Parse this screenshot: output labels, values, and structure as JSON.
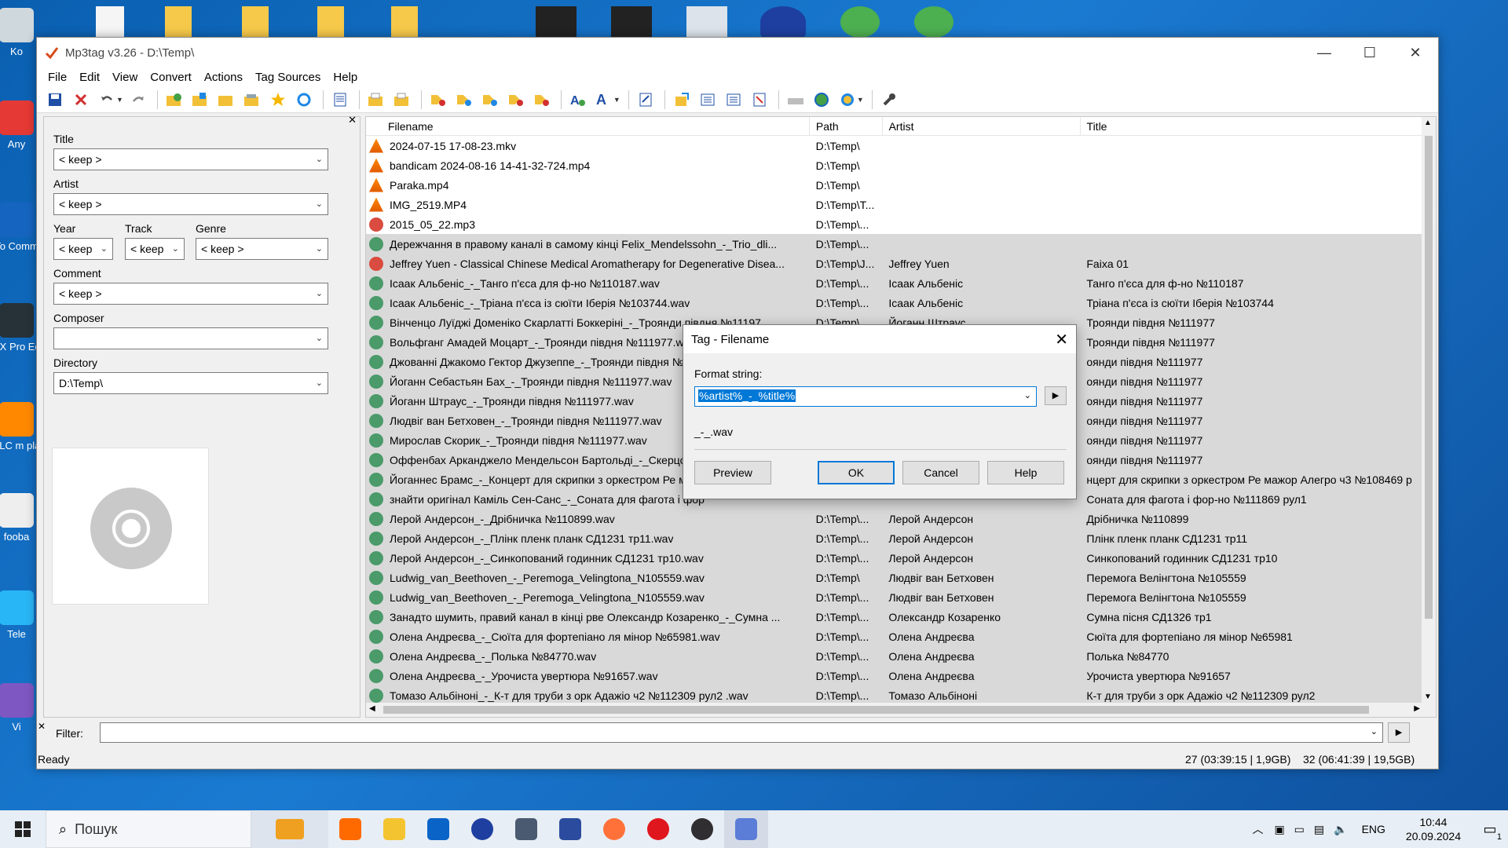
{
  "desktop": {
    "icons": [
      {
        "label": "Ko",
        "color": "#cfd8dc"
      },
      {
        "label": "Any",
        "color": "#e53935"
      },
      {
        "label": "To Comm",
        "color": "#1565c0"
      },
      {
        "label": "RX Pro Ed",
        "color": "#263238"
      },
      {
        "label": "VLC m pla",
        "color": "#ff8800"
      },
      {
        "label": "fooba",
        "color": "#eeeeee"
      },
      {
        "label": "Tele",
        "color": "#29b6f6"
      },
      {
        "label": "Vi",
        "color": "#7e57c2"
      }
    ]
  },
  "window": {
    "title": "Mp3tag v3.26  -  D:\\Temp\\",
    "controls": {
      "minimize": "—",
      "maximize": "☐",
      "close": "✕"
    }
  },
  "menu": [
    "File",
    "Edit",
    "View",
    "Convert",
    "Actions",
    "Tag Sources",
    "Help"
  ],
  "toolbar": {
    "icons": [
      "save-icon",
      "remove-tag-icon",
      "undo-icon",
      "redo-icon",
      "add-directory-icon",
      "add-file-icon",
      "open-folder-icon",
      "favorites-icon",
      "star-icon",
      "refresh-icon",
      "tag-panel-icon",
      "playlist-icon",
      "export-icon",
      "tag-filename-icon",
      "filename-tag-icon",
      "text-tag-icon",
      "tag-tag-icon",
      "autonumber-icon",
      "case-conversion-icon",
      "font-icon",
      "extended-tags-icon",
      "move-icon",
      "tag-source-icon",
      "web-icon",
      "globe-icon",
      "settings-wrench-icon"
    ]
  },
  "tagpanel": {
    "title_label": "Title",
    "title_value": "< keep >",
    "artist_label": "Artist",
    "artist_value": "< keep >",
    "year_label": "Year",
    "year_value": "< keep",
    "track_label": "Track",
    "track_value": "< keep",
    "genre_label": "Genre",
    "genre_value": "< keep >",
    "comment_label": "Comment",
    "comment_value": "< keep >",
    "composer_label": "Composer",
    "composer_value": "",
    "directory_label": "Directory",
    "directory_value": "D:\\Temp\\"
  },
  "list": {
    "columns": [
      "Filename",
      "Path",
      "Artist",
      "Title"
    ],
    "rows": [
      {
        "type": "vlc",
        "file": "2024-07-15 17-08-23.mkv",
        "path": "D:\\Temp\\",
        "artist": "",
        "title": "",
        "sel": false
      },
      {
        "type": "vlc",
        "file": "bandicam 2024-08-16 14-41-32-724.mp4",
        "path": "D:\\Temp\\",
        "artist": "",
        "title": "",
        "sel": false
      },
      {
        "type": "vlc",
        "file": "Paraka.mp4",
        "path": "D:\\Temp\\",
        "artist": "",
        "title": "",
        "sel": false
      },
      {
        "type": "vlc",
        "file": "IMG_2519.MP4",
        "path": "D:\\Temp\\T...",
        "artist": "",
        "title": "",
        "sel": false
      },
      {
        "type": "mp3",
        "file": "2015_05_22.mp3",
        "path": "D:\\Temp\\...",
        "artist": "",
        "title": "",
        "sel": false
      },
      {
        "type": "wav",
        "file": "Дережчання в правому каналі в самому кінці Felix_Mendelssohn_-_Trio_dli...",
        "path": "D:\\Temp\\...",
        "artist": "",
        "title": "",
        "sel": true
      },
      {
        "type": "mp3",
        "file": "Jeffrey Yuen - Classical Chinese Medical Aromatherapy for Degenerative Disea...",
        "path": "D:\\Temp\\J...",
        "artist": "Jeffrey Yuen",
        "title": "Faixa 01",
        "sel": true
      },
      {
        "type": "wav",
        "file": "Ісаак Альбеніс_-_Танго п'єса для ф-но №110187.wav",
        "path": "D:\\Temp\\...",
        "artist": "Ісаак Альбеніс",
        "title": "Танго п'єса для ф-но №110187",
        "sel": true
      },
      {
        "type": "wav",
        "file": "Ісаак Альбеніс_-_Тріана п'єса із сюїти Іберія №103744.wav",
        "path": "D:\\Temp\\...",
        "artist": "Ісаак Альбеніс",
        "title": "Тріана п'єса із сюїти Іберія №103744",
        "sel": true
      },
      {
        "type": "wav",
        "file": "Вінченцо Луїджі Доменіко Скарлатті Боккеріні_-_Троянди півдня №11197...",
        "path": "D:\\Temp\\...",
        "artist": "Йоганн Штраус",
        "title": "Троянди півдня №111977",
        "sel": true
      },
      {
        "type": "wav",
        "file": "Вольфганг Амадей Моцарт_-_Троянди півдня №111977.wav",
        "path": "D:\\Temp\\...",
        "artist": "",
        "title": "Троянди півдня №111977",
        "sel": true
      },
      {
        "type": "wav",
        "file": "Джованні Джакомо Гектор Джузеппе_-_Троянди півдня №1",
        "path": "",
        "artist": "",
        "title": "оянди півдня №111977",
        "sel": true
      },
      {
        "type": "wav",
        "file": "Йоганн Себастьян Бах_-_Троянди півдня №111977.wav",
        "path": "",
        "artist": "",
        "title": "оянди півдня №111977",
        "sel": true
      },
      {
        "type": "wav",
        "file": "Йоганн Штраус_-_Троянди півдня №111977.wav",
        "path": "",
        "artist": "",
        "title": "оянди півдня №111977",
        "sel": true
      },
      {
        "type": "wav",
        "file": "Людвіг ван Бетховен_-_Троянди півдня №111977.wav",
        "path": "",
        "artist": "",
        "title": "оянди півдня №111977",
        "sel": true
      },
      {
        "type": "wav",
        "file": "Мирослав Скорик_-_Троянди півдня №111977.wav",
        "path": "",
        "artist": "",
        "title": "оянди півдня №111977",
        "sel": true
      },
      {
        "type": "wav",
        "file": "Оффенбах Арканджело Мендельсон Бартольді_-_Скерцо Тр",
        "path": "",
        "artist": "",
        "title": "оянди півдня №111977",
        "sel": true
      },
      {
        "type": "wav",
        "file": "Йоганнес Брамс_-_Концерт для скрипки з оркестром Ре ма",
        "path": "",
        "artist": "",
        "title": "нцерт для скрипки з оркестром Ре мажор Алегро ч3 №108469 р",
        "sel": true
      },
      {
        "type": "wav",
        "file": "знайти оригінал Каміль Сен-Санс_-_Соната для фагота і фор",
        "path": "",
        "artist": "",
        "title": "Соната для фагота і фор-но №111869 рул1",
        "sel": true
      },
      {
        "type": "wav",
        "file": "Лерой Андерсон_-_Дрібничка №110899.wav",
        "path": "D:\\Temp\\...",
        "artist": "Лерой Андерсон",
        "title": "Дрібничка №110899",
        "sel": true
      },
      {
        "type": "wav",
        "file": "Лерой Андерсон_-_Плінк пленк планк СД1231 тр11.wav",
        "path": "D:\\Temp\\...",
        "artist": "Лерой Андерсон",
        "title": "Плінк пленк планк СД1231 тр11",
        "sel": true
      },
      {
        "type": "wav",
        "file": "Лерой Андерсон_-_Синкопований годинник СД1231 тр10.wav",
        "path": "D:\\Temp\\...",
        "artist": "Лерой Андерсон",
        "title": "Синкопований годинник СД1231 тр10",
        "sel": true
      },
      {
        "type": "wav",
        "file": "Ludwig_van_Beethoven_-_Peremoga_Velingtona_N105559.wav",
        "path": "D:\\Temp\\",
        "artist": "Людвіг ван Бетховен",
        "title": "Перемога Велінгтона №105559",
        "sel": true
      },
      {
        "type": "wav",
        "file": "Ludwig_van_Beethoven_-_Peremoga_Velingtona_N105559.wav",
        "path": "D:\\Temp\\...",
        "artist": "Людвіг ван Бетховен",
        "title": "Перемога Велінгтона №105559",
        "sel": true
      },
      {
        "type": "wav",
        "file": "Занадто шумить, правий канал в кінці рве Олександр Козаренко_-_Сумна ...",
        "path": "D:\\Temp\\...",
        "artist": "Олександр Козаренко",
        "title": "Сумна пісня СД1326 тр1",
        "sel": true
      },
      {
        "type": "wav",
        "file": "Олена Андреєва_-_Сюїта для фортепіано ля мінор №65981.wav",
        "path": "D:\\Temp\\...",
        "artist": "Олена Андреєва",
        "title": "Сюїта для фортепіано ля мінор №65981",
        "sel": true
      },
      {
        "type": "wav",
        "file": "Олена Андреєва_-_Полька  №84770.wav",
        "path": "D:\\Temp\\...",
        "artist": "Олена Андреєва",
        "title": "Полька  №84770",
        "sel": true
      },
      {
        "type": "wav",
        "file": "Олена Андреєва_-_Урочиста увертюра №91657.wav",
        "path": "D:\\Temp\\...",
        "artist": "Олена Андреєва",
        "title": "Урочиста увертюра №91657",
        "sel": true
      },
      {
        "type": "wav",
        "file": "Томазо Альбіноні_-_К-т для труби з орк Адажіо ч2 №112309 рул2 .wav",
        "path": "D:\\Temp\\...",
        "artist": "Томазо Альбіноні",
        "title": "К-т для труби з орк Адажіо ч2 №112309 рул2",
        "sel": true
      }
    ]
  },
  "filter": {
    "label": "Filter:",
    "value": ""
  },
  "status": {
    "left": "Ready",
    "selected": "27 (03:39:15 | 1,9GB)",
    "total": "32 (06:41:39 | 19,5GB)"
  },
  "dialog": {
    "title": "Tag - Filename",
    "format_label": "Format string:",
    "format_value": "%artist%_-_%title%",
    "preview_text": "_-_.wav",
    "buttons": {
      "preview": "Preview",
      "ok": "OK",
      "cancel": "Cancel",
      "help": "Help"
    }
  },
  "taskbar": {
    "search_placeholder": "Пошук",
    "apps": [
      {
        "name": "briefcase",
        "color": "#f0a020"
      },
      {
        "name": "browser",
        "color": "#ff6a00"
      },
      {
        "name": "explorer",
        "color": "#f4c430"
      },
      {
        "name": "outlook",
        "color": "#0a64c8"
      },
      {
        "name": "headphones",
        "color": "#1e3fa0"
      },
      {
        "name": "app",
        "color": "#4a5a70"
      },
      {
        "name": "save",
        "color": "#2b4c9e"
      },
      {
        "name": "firefox",
        "color": "#ff7139"
      },
      {
        "name": "opera",
        "color": "#e0161e"
      },
      {
        "name": "obs",
        "color": "#302e31"
      },
      {
        "name": "mp3tag",
        "color": "#5b7dd8"
      }
    ],
    "lang": "ENG",
    "time": "10:44",
    "date": "20.09.2024",
    "notifications": "1"
  }
}
